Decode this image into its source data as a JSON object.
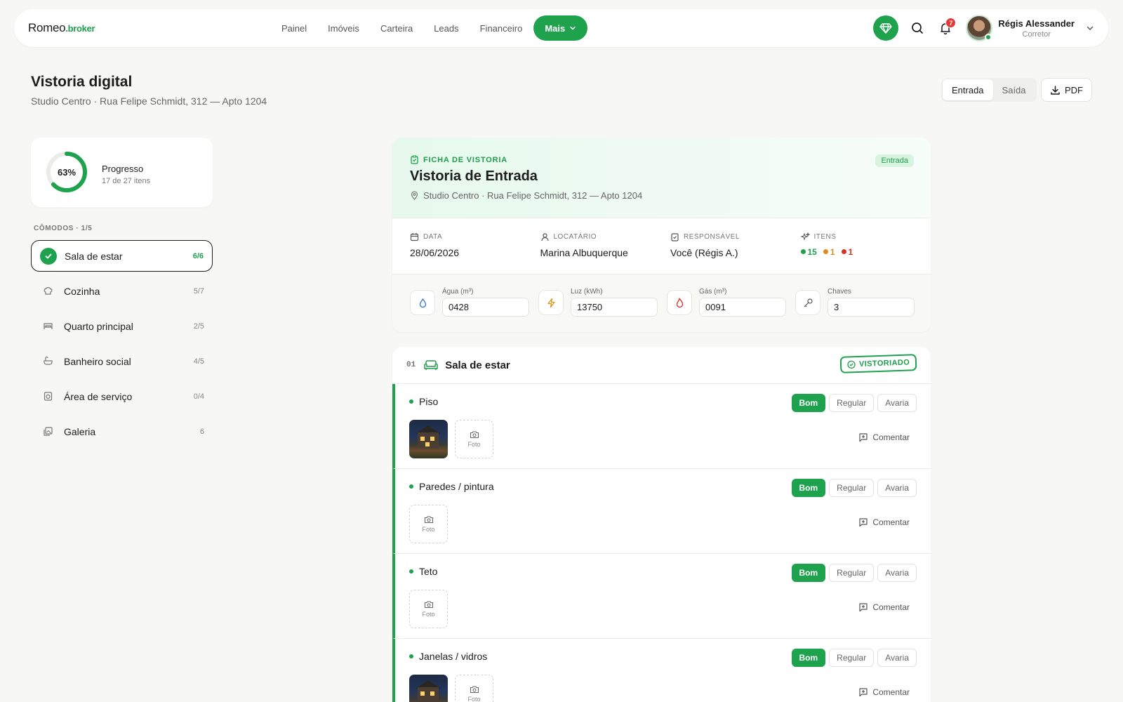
{
  "nav": {
    "logo_main": "Romeo",
    "logo_suffix": ".broker",
    "links": [
      "Painel",
      "Imóveis",
      "Carteira",
      "Leads",
      "Financeiro"
    ],
    "more_label": "Mais",
    "notifications": "7",
    "user_name": "Régis Alessander",
    "user_role": "Corretor"
  },
  "header": {
    "title": "Vistoria digital",
    "subtitle": "Studio Centro · Rua Felipe Schmidt, 312 — Apto 1204",
    "seg_entrada": "Entrada",
    "seg_saida": "Saída",
    "pdf_label": "PDF"
  },
  "progress": {
    "percent_label": "63%",
    "percent_value": 0.63,
    "label": "Progresso",
    "sub": "17 de 27 itens"
  },
  "rooms": {
    "heading": "CÔMODOS · 1/5",
    "items": [
      {
        "name": "Sala de estar",
        "count": "6/6"
      },
      {
        "name": "Cozinha",
        "count": "5/7"
      },
      {
        "name": "Quarto principal",
        "count": "2/5"
      },
      {
        "name": "Banheiro social",
        "count": "4/5"
      },
      {
        "name": "Área de serviço",
        "count": "0/4"
      },
      {
        "name": "Galeria",
        "count": "6"
      }
    ]
  },
  "ficha": {
    "kicker": "FICHA DE VISTORIA",
    "title": "Vistoria de Entrada",
    "address": "Studio Centro · Rua Felipe Schmidt, 312 — Apto 1204",
    "badge": "Entrada",
    "meta": {
      "data_label": "DATA",
      "data_value": "28/06/2026",
      "locatario_label": "LOCATÁRIO",
      "locatario_value": "Marina Albuquerque",
      "responsavel_label": "RESPONSÁVEL",
      "responsavel_value": "Você (Régis A.)",
      "itens_label": "ITENS",
      "itens_good": "15",
      "itens_regular": "1",
      "itens_bad": "1"
    },
    "meters": {
      "agua_label": "Água (m³)",
      "agua_value": "0428",
      "luz_label": "Luz (kWh)",
      "luz_value": "13750",
      "gas_label": "Gás (m³)",
      "gas_value": "0091",
      "chaves_label": "Chaves",
      "chaves_value": "3"
    }
  },
  "room_card": {
    "number": "01",
    "title": "Sala de estar",
    "stamp": "VISTORIADO",
    "status_good": "Bom",
    "status_regular": "Regular",
    "status_bad": "Avaria",
    "photo_label": "Foto",
    "comment_label": "Comentar",
    "items": [
      {
        "name": "Piso"
      },
      {
        "name": "Paredes / pintura"
      },
      {
        "name": "Teto"
      },
      {
        "name": "Janelas / vidros"
      }
    ]
  },
  "colors": {
    "accent": "#1fa24e",
    "good": "#1fa24e",
    "regular": "#e08a1e",
    "bad": "#d93025"
  }
}
